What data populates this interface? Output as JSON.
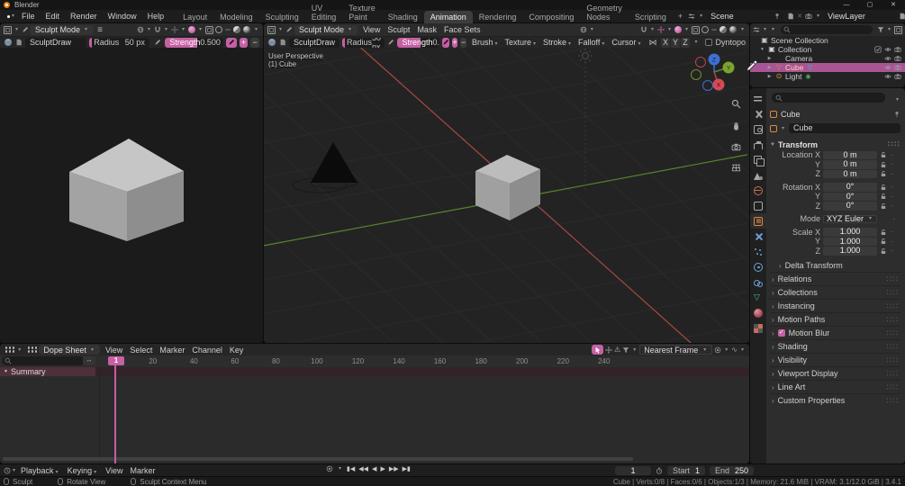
{
  "window": {
    "title": "Blender"
  },
  "icons": {
    "caret": "▾",
    "menu": "≡",
    "warning": "⚠",
    "symmetry": "⋈",
    "plus": "+",
    "minus": "−",
    "minimize": "—",
    "maximize": "▢",
    "close": "✕",
    "collapse_down": "▼",
    "collapse_right": "▶",
    "chevron": "›",
    "drag_dots": "∷∷",
    "expand_h": "↔",
    "dot": "·",
    "transport": {
      "jump_first": "▮◀",
      "prev_key": "◀◀",
      "play_rev": "◀",
      "play": "▶",
      "next_key": "▶▶",
      "jump_last": "▶▮"
    }
  },
  "colors": {
    "accent": "#c560a3",
    "selection": "#a85596",
    "object_orange": "#e0883c",
    "axis_x": "#a84a45",
    "axis_y": "#55862f",
    "axis_z": "#3d6fd2"
  },
  "topbar": {
    "menus": [
      "File",
      "Edit",
      "Render",
      "Window",
      "Help"
    ],
    "workspaces": [
      {
        "label": "Layout"
      },
      {
        "label": "Modeling"
      },
      {
        "label": "Sculpting"
      },
      {
        "label": "UV Editing"
      },
      {
        "label": "Texture Paint"
      },
      {
        "label": "Shading"
      },
      {
        "label": "Animation",
        "active": true
      },
      {
        "label": "Rendering"
      },
      {
        "label": "Compositing"
      },
      {
        "label": "Geometry Nodes"
      },
      {
        "label": "Scripting"
      }
    ],
    "add_workspace": "+",
    "scene": "Scene",
    "view_layer": "ViewLayer"
  },
  "sculpt_header": {
    "mode": "Sculpt Mode",
    "menus": [
      "View",
      "Sculpt",
      "Mask",
      "Face Sets"
    ]
  },
  "tool_settings": {
    "brush_name": "SculptDraw",
    "radius_label": "Radius",
    "radius_value": "50 px",
    "strength_label": "Strength",
    "strength_value": "0.500",
    "dropdowns": [
      "Brush",
      "Texture",
      "Stroke",
      "Falloff",
      "Cursor"
    ],
    "symmetry_axes": [
      "X",
      "Y",
      "Z"
    ],
    "dyntopo_label": "Dyntopo"
  },
  "viewport": {
    "overlay_line1": "User Perspective",
    "overlay_line2": "(1) Cube",
    "axis_x": "X",
    "axis_y": "Y",
    "axis_z": "Z"
  },
  "outliner": {
    "rows": [
      {
        "label": "Scene Collection",
        "icon": "scene-collection",
        "depth": 0,
        "toggle": ""
      },
      {
        "label": "Collection",
        "icon": "collection",
        "depth": 1,
        "toggle": "▼",
        "has_checkbox": true,
        "has_eye": true,
        "has_camera": true
      },
      {
        "label": "Camera",
        "icon": "camera",
        "badge": "camera-data",
        "depth": 2,
        "toggle": "▶",
        "has_eye": true,
        "has_camera": true
      },
      {
        "label": "Cube",
        "icon": "mesh",
        "badge": "mesh-data",
        "depth": 2,
        "toggle": "▶",
        "active": true,
        "has_eye": true,
        "has_camera": true
      },
      {
        "label": "Light",
        "icon": "light",
        "badge": "light-data",
        "depth": 2,
        "toggle": "▶",
        "has_eye": true,
        "has_camera": true
      }
    ]
  },
  "properties": {
    "tabs": [
      {
        "icon": "tool"
      },
      {
        "icon": "render"
      },
      {
        "icon": "output"
      },
      {
        "icon": "viewlayer"
      },
      {
        "icon": "scene"
      },
      {
        "icon": "world"
      },
      {
        "icon": "collection"
      },
      {
        "icon": "object",
        "active": true
      },
      {
        "icon": "modifiers"
      },
      {
        "icon": "particles"
      },
      {
        "icon": "physics"
      },
      {
        "icon": "constraints"
      },
      {
        "icon": "data"
      },
      {
        "icon": "material"
      },
      {
        "icon": "texture"
      }
    ],
    "breadcrumb": "Cube",
    "object_name": "Cube",
    "transform": {
      "title": "Transform",
      "location_rows": [
        {
          "label": "Location X",
          "value": "0 m"
        },
        {
          "label": "Y",
          "value": "0 m"
        },
        {
          "label": "Z",
          "value": "0 m"
        }
      ],
      "rotation_rows": [
        {
          "label": "Rotation X",
          "value": "0°"
        },
        {
          "label": "Y",
          "value": "0°"
        },
        {
          "label": "Z",
          "value": "0°"
        }
      ],
      "mode_label": "Mode",
      "mode_value": "XYZ Euler",
      "scale_rows": [
        {
          "label": "Scale X",
          "value": "1.000"
        },
        {
          "label": "Y",
          "value": "1.000"
        },
        {
          "label": "Z",
          "value": "1.000"
        }
      ],
      "sub_panel": "Delta Transform"
    },
    "panels": [
      {
        "label": "Relations"
      },
      {
        "label": "Collections"
      },
      {
        "label": "Instancing"
      },
      {
        "label": "Motion Paths"
      },
      {
        "label": "Motion Blur",
        "checkbox": true
      },
      {
        "label": "Shading"
      },
      {
        "label": "Visibility"
      },
      {
        "label": "Viewport Display"
      },
      {
        "label": "Line Art"
      },
      {
        "label": "Custom Properties"
      }
    ]
  },
  "dopesheet": {
    "editor_label": "Dope Sheet",
    "menus": [
      "View",
      "Select",
      "Marker",
      "Channel",
      "Key"
    ],
    "snap_value": "Nearest Frame",
    "current_frame": "1",
    "ruler_ticks": [
      "20",
      "40",
      "60",
      "80",
      "100",
      "120",
      "140",
      "160",
      "180",
      "200",
      "220",
      "240"
    ],
    "summary_label": "Summary"
  },
  "timeline": {
    "menus": [
      {
        "label": "Playback",
        "caret": true
      },
      {
        "label": "Keying",
        "caret": true
      },
      {
        "label": "View"
      },
      {
        "label": "Marker"
      }
    ],
    "current_frame": "1",
    "start_label": "Start",
    "start_value": "1",
    "end_label": "End",
    "end_value": "250"
  },
  "statusbar": {
    "hints": [
      {
        "button": "l",
        "label": "Sculpt"
      },
      {
        "button": "m",
        "label": "Rotate View"
      },
      {
        "button": "r",
        "label": "Sculpt Context Menu"
      }
    ],
    "stats": "Cube | Verts:0/8 | Faces:0/6 | Objects:1/3 | Memory: 21.6 MiB | VRAM: 3.1/12.0 GiB | 3.4.1"
  }
}
